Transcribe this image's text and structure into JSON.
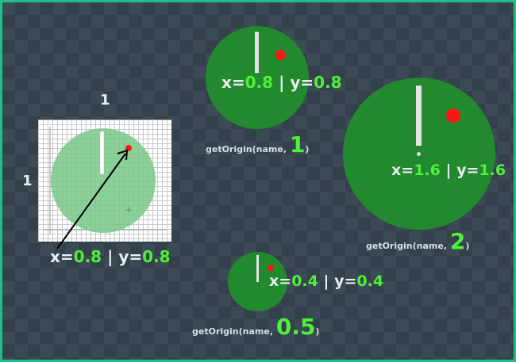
{
  "dimension_labels": {
    "width": "1",
    "height": "1"
  },
  "main_example": {
    "x_label": "x=",
    "x_value": "0.8",
    "separator": "|",
    "y_label": "y=",
    "y_value": "0.8"
  },
  "examples": [
    {
      "call_prefix": "getOrigin(name, ",
      "scale": "1",
      "call_suffix": ")",
      "x_label": "x=",
      "x_value": "0.8",
      "separator": "|",
      "y_label": "y=",
      "y_value": "0.8"
    },
    {
      "call_prefix": "getOrigin(name, ",
      "scale": "2",
      "call_suffix": ")",
      "x_label": "x=",
      "x_value": "1.6",
      "separator": "|",
      "y_label": "y=",
      "y_value": "1.6"
    },
    {
      "call_prefix": "getOrigin(name, ",
      "scale": "0.5",
      "call_suffix": ")",
      "x_label": "x=",
      "x_value": "0.4",
      "separator": "|",
      "y_label": "y=",
      "y_value": "0.4"
    }
  ],
  "colors": {
    "background": "#3c4a56",
    "border": "#1fbf8a",
    "circle": "#23892e",
    "value": "#4ef03a",
    "origin_dot": "#ff1414",
    "needle": "#e3e3e3"
  }
}
